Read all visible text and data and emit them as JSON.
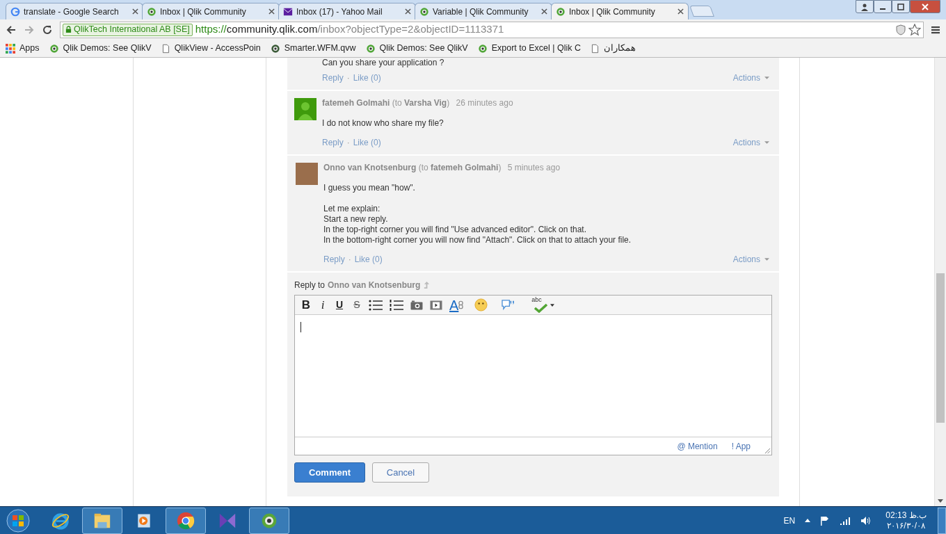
{
  "browser": {
    "tabs": [
      {
        "title": "translate - Google Search",
        "kind": "google",
        "selected": false
      },
      {
        "title": "Inbox | Qlik Community",
        "kind": "qlik",
        "selected": false
      },
      {
        "title": "Inbox (17) - Yahoo Mail",
        "kind": "mail",
        "selected": false
      },
      {
        "title": "Variable | Qlik Community",
        "kind": "qlik",
        "selected": false
      },
      {
        "title": "Inbox | Qlik Community",
        "kind": "qlik",
        "selected": true
      }
    ],
    "address": {
      "security_label": "QlikTech International AB [SE]",
      "scheme": "https://",
      "host": "community.qlik.com",
      "path": "/inbox?objectType=2&objectID=1113371"
    },
    "bookmarks": [
      {
        "label": "Apps",
        "kind": "apps"
      },
      {
        "label": "Qlik Demos: See QlikV",
        "kind": "qlik"
      },
      {
        "label": "QlikView - AccessPoin",
        "kind": "page"
      },
      {
        "label": "Smarter.WFM.qvw",
        "kind": "qlikdark"
      },
      {
        "label": "Qlik Demos: See QlikV",
        "kind": "qlik"
      },
      {
        "label": "Export to Excel | Qlik C",
        "kind": "qlik"
      },
      {
        "label": "همکاران",
        "kind": "page"
      }
    ]
  },
  "previous_comment": {
    "body": "Can you share your application ?",
    "reply": "Reply",
    "separator": "·",
    "like": "Like (0)",
    "actions": "Actions"
  },
  "comments": [
    {
      "author": "fatemeh Golmahi",
      "to_prefix": "(to",
      "to": "Varsha Vig",
      "to_suffix": ")",
      "time": "26 minutes ago",
      "kind": "silhouette",
      "body": [
        "I do not know who share my file?"
      ],
      "reply": "Reply",
      "separator": "·",
      "like": "Like (0)",
      "actions": "Actions"
    },
    {
      "author": "Onno van Knotsenburg",
      "to_prefix": "(to",
      "to": "fatemeh Golmahi",
      "to_suffix": ")",
      "time": "5 minutes ago",
      "kind": "photo",
      "body": [
        "I guess you mean \"how\".",
        "Let me explain:\nStart a new reply.\nIn the top-right corner you will find \"Use advanced editor\". Click on that.\nIn the bottom-right corner you will now find \"Attach\". Click on that to attach your file."
      ],
      "reply": "Reply",
      "separator": "·",
      "like": "Like (0)",
      "actions": "Actions"
    }
  ],
  "reply_box": {
    "label": "Reply to",
    "target": "Onno van Knotsenburg",
    "tools": [
      {
        "kind": "bold",
        "label": "B"
      },
      {
        "kind": "italic",
        "label": "i"
      },
      {
        "kind": "underline",
        "label": "U"
      },
      {
        "kind": "strike",
        "label": "S"
      },
      {
        "kind": "bullets"
      },
      {
        "kind": "numbers"
      },
      {
        "kind": "image"
      },
      {
        "kind": "video"
      },
      {
        "kind": "link",
        "label": "A"
      },
      {
        "kind": "emoji"
      },
      {
        "kind": "quote"
      },
      {
        "kind": "spell",
        "label": "abc"
      }
    ],
    "mention": "@ Mention",
    "app": "! App",
    "comment_button": "Comment",
    "cancel_button": "Cancel"
  },
  "taskbar": {
    "apps": [
      {
        "kind": "ie",
        "active": false
      },
      {
        "kind": "explorer",
        "active": true
      },
      {
        "kind": "media",
        "active": false
      },
      {
        "kind": "chrome",
        "active": true
      },
      {
        "kind": "vs",
        "active": false
      },
      {
        "kind": "qlik",
        "active": true
      }
    ],
    "language": "EN",
    "time": "02:13 ب.ظ",
    "date": "۲۰۱۶/۳۰/۰۸"
  }
}
